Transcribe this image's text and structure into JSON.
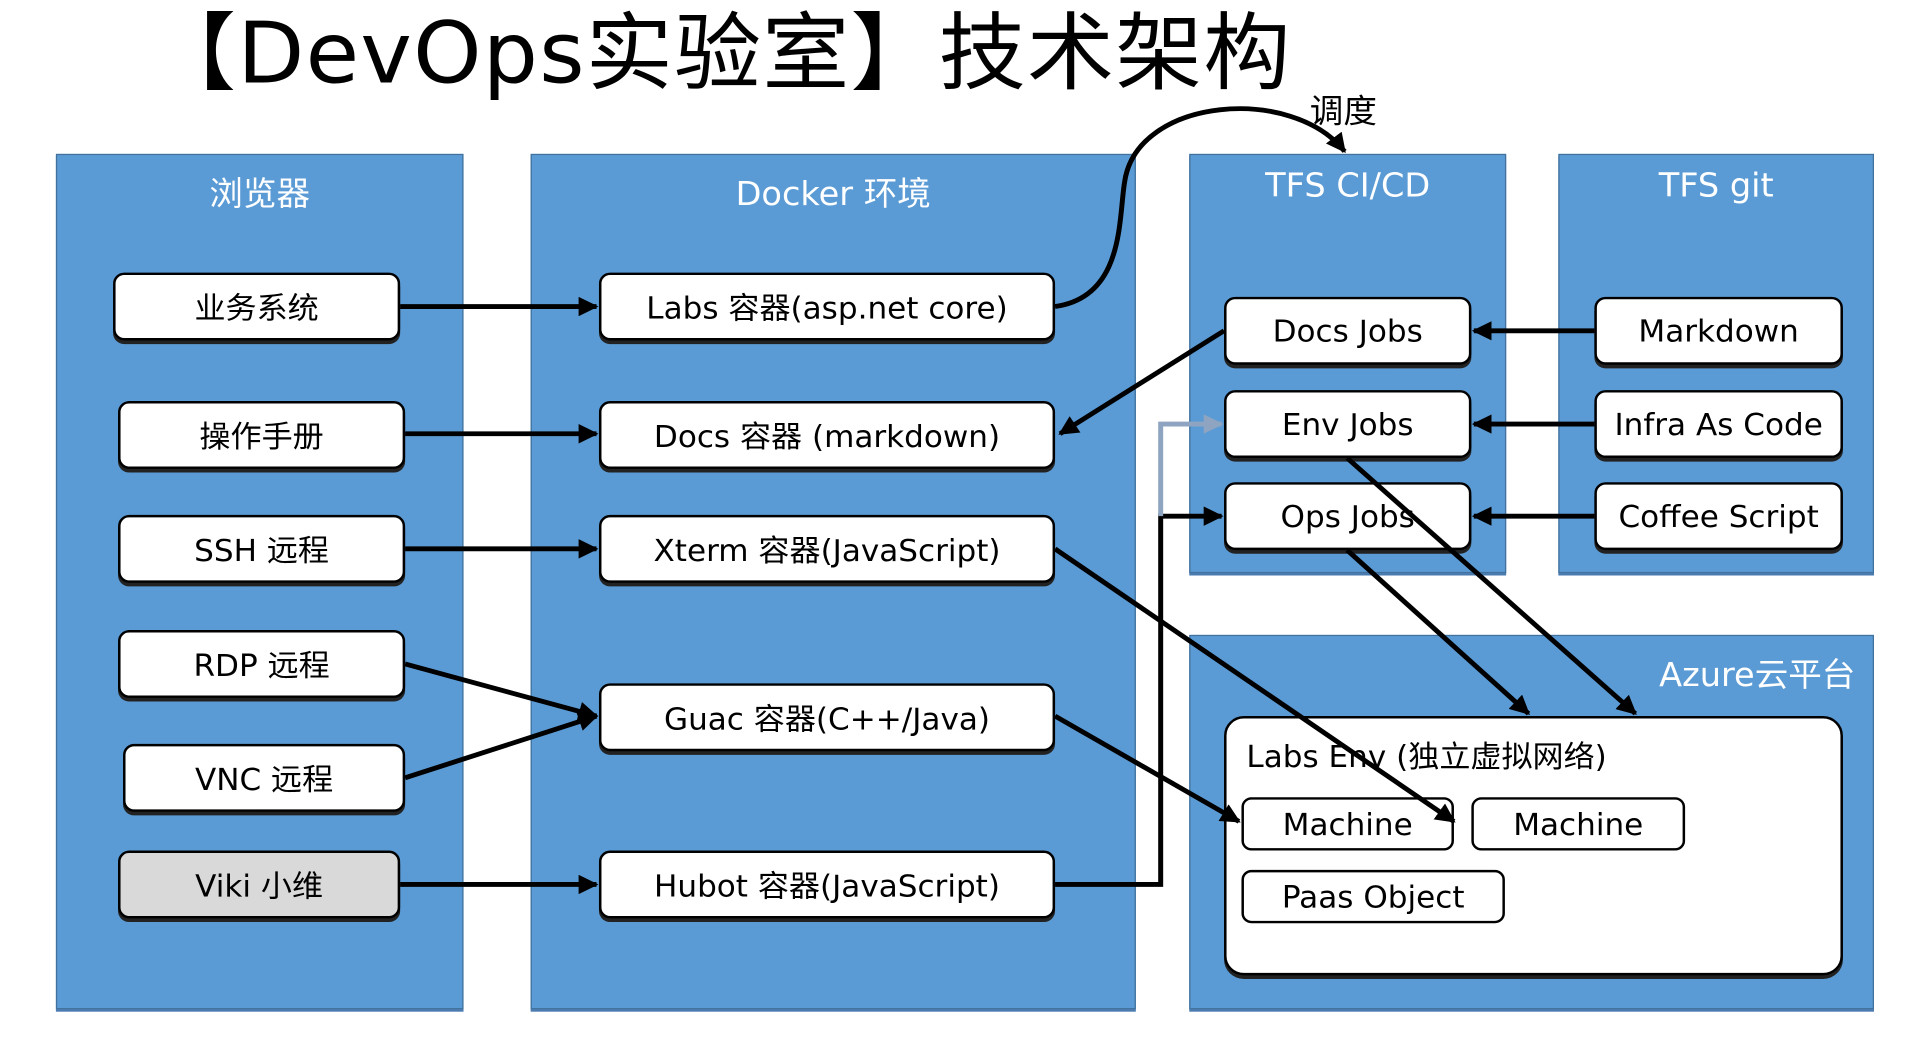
{
  "title": "【DevOps实验室】技术架构",
  "schedule_label": "调度",
  "colors": {
    "panel": "#5b9bd5",
    "node": "#ffffff",
    "highlight_node": "#d9d9d9",
    "arrow": "#000000",
    "arrow_muted": "#8ea4c0"
  },
  "panels": {
    "browser": {
      "title": "浏览器",
      "nodes": [
        "业务系统",
        "操作手册",
        "SSH 远程",
        "RDP 远程",
        "VNC 远程",
        "Viki 小维"
      ]
    },
    "docker": {
      "title": "Docker 环境",
      "nodes": [
        "Labs 容器(asp.net core)",
        "Docs 容器 (markdown)",
        "Xterm 容器(JavaScript)",
        "Guac 容器(C++/Java)",
        "Hubot 容器(JavaScript)"
      ]
    },
    "tfs_cicd": {
      "title": "TFS CI/CD",
      "nodes": [
        "Docs Jobs",
        "Env Jobs",
        "Ops Jobs"
      ]
    },
    "tfs_git": {
      "title": "TFS git",
      "nodes": [
        "Markdown",
        "Infra As Code",
        "Coffee Script"
      ]
    },
    "azure": {
      "title": "Azure云平台",
      "env_title": "Labs Env (独立虚拟网络)",
      "nodes": [
        "Machine",
        "Machine",
        "Paas Object"
      ]
    }
  },
  "connections": [
    {
      "from": "业务系统",
      "to": "Labs 容器(asp.net core)"
    },
    {
      "from": "操作手册",
      "to": "Docs 容器 (markdown)"
    },
    {
      "from": "SSH 远程",
      "to": "Xterm 容器(JavaScript)"
    },
    {
      "from": "RDP 远程",
      "to": "Guac 容器(C++/Java)"
    },
    {
      "from": "VNC 远程",
      "to": "Guac 容器(C++/Java)"
    },
    {
      "from": "Viki 小维",
      "to": "Hubot 容器(JavaScript)"
    },
    {
      "from": "Labs 容器(asp.net core)",
      "to": "TFS CI/CD",
      "label": "调度"
    },
    {
      "from": "Docs Jobs",
      "to": "Docs 容器 (markdown)"
    },
    {
      "from": "Markdown",
      "to": "Docs Jobs"
    },
    {
      "from": "Infra As Code",
      "to": "Env Jobs"
    },
    {
      "from": "Coffee Script",
      "to": "Ops Jobs"
    },
    {
      "from": "Hubot 容器(JavaScript)",
      "to": "Ops Jobs"
    },
    {
      "from": "Hubot 容器(JavaScript)",
      "to": "Env Jobs",
      "style": "muted"
    },
    {
      "from": "Xterm 容器(JavaScript)",
      "to": "Machine (2)"
    },
    {
      "from": "Guac 容器(C++/Java)",
      "to": "Machine (1)"
    },
    {
      "from": "Env Jobs",
      "to": "Labs Env"
    },
    {
      "from": "Ops Jobs",
      "to": "Labs Env"
    }
  ]
}
